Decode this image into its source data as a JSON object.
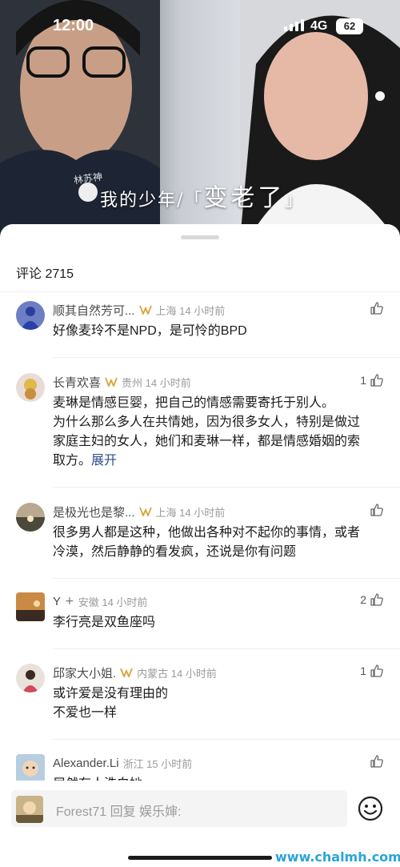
{
  "status_bar": {
    "time": "12:00",
    "network": "4G",
    "battery": "62"
  },
  "video": {
    "subtitle_pre": "我的少年",
    "subtitle_post": "变老了",
    "signature": "林苏神"
  },
  "comments_header": {
    "title": "评论 2715"
  },
  "comments": [
    {
      "user": "顺其自然芳可...",
      "location": "上海 14 小时前",
      "text": [
        "好像麦玲不是NPD，是可怜的BPD"
      ],
      "likes": ""
    },
    {
      "user": "长青欢喜",
      "location": "贵州 14 小时前",
      "text": [
        "麦琳是情感巨婴，把自己的情感需要寄托于别人。",
        "为什么那么多人在共情她，因为很多女人，特别是做过",
        "家庭主妇的女人，她们和麦琳一样，都是情感婚姻的索",
        "取方。"
      ],
      "expand": "展开",
      "likes": "1"
    },
    {
      "user": "是极光也是黎...",
      "location": "上海 14 小时前",
      "text": [
        "很多男人都是这种，他做出各种对不起你的事情，或者",
        "冷漠，然后静静的看发疯，还说是你有问题"
      ],
      "likes": ""
    },
    {
      "user": "Y",
      "location": "安徽 14 小时前",
      "text": [
        "李行亮是双鱼座吗"
      ],
      "likes": "2"
    },
    {
      "user": "邱家大小姐.",
      "location": "内蒙古 14 小时前",
      "text": [
        "或许爱是没有理由的",
        "不爱也一样"
      ],
      "likes": "1"
    },
    {
      "user": "Alexander.Li",
      "location": "浙江 15 小时前",
      "text": [
        "居然有人洗白她"
      ],
      "likes": ""
    }
  ],
  "reply_bar": {
    "placeholder": "Forest71 回复 娱乐婶:"
  },
  "watermark": "www.chalmh.com",
  "icons": {
    "like": "thumbs-up-icon",
    "vip": "vip-badge-icon",
    "emoji": "smile-emoji-icon"
  },
  "colors": {
    "vip_gold": "#d9a23a",
    "link_blue": "#2b4f8a",
    "watermark": "#2aa4d9"
  }
}
